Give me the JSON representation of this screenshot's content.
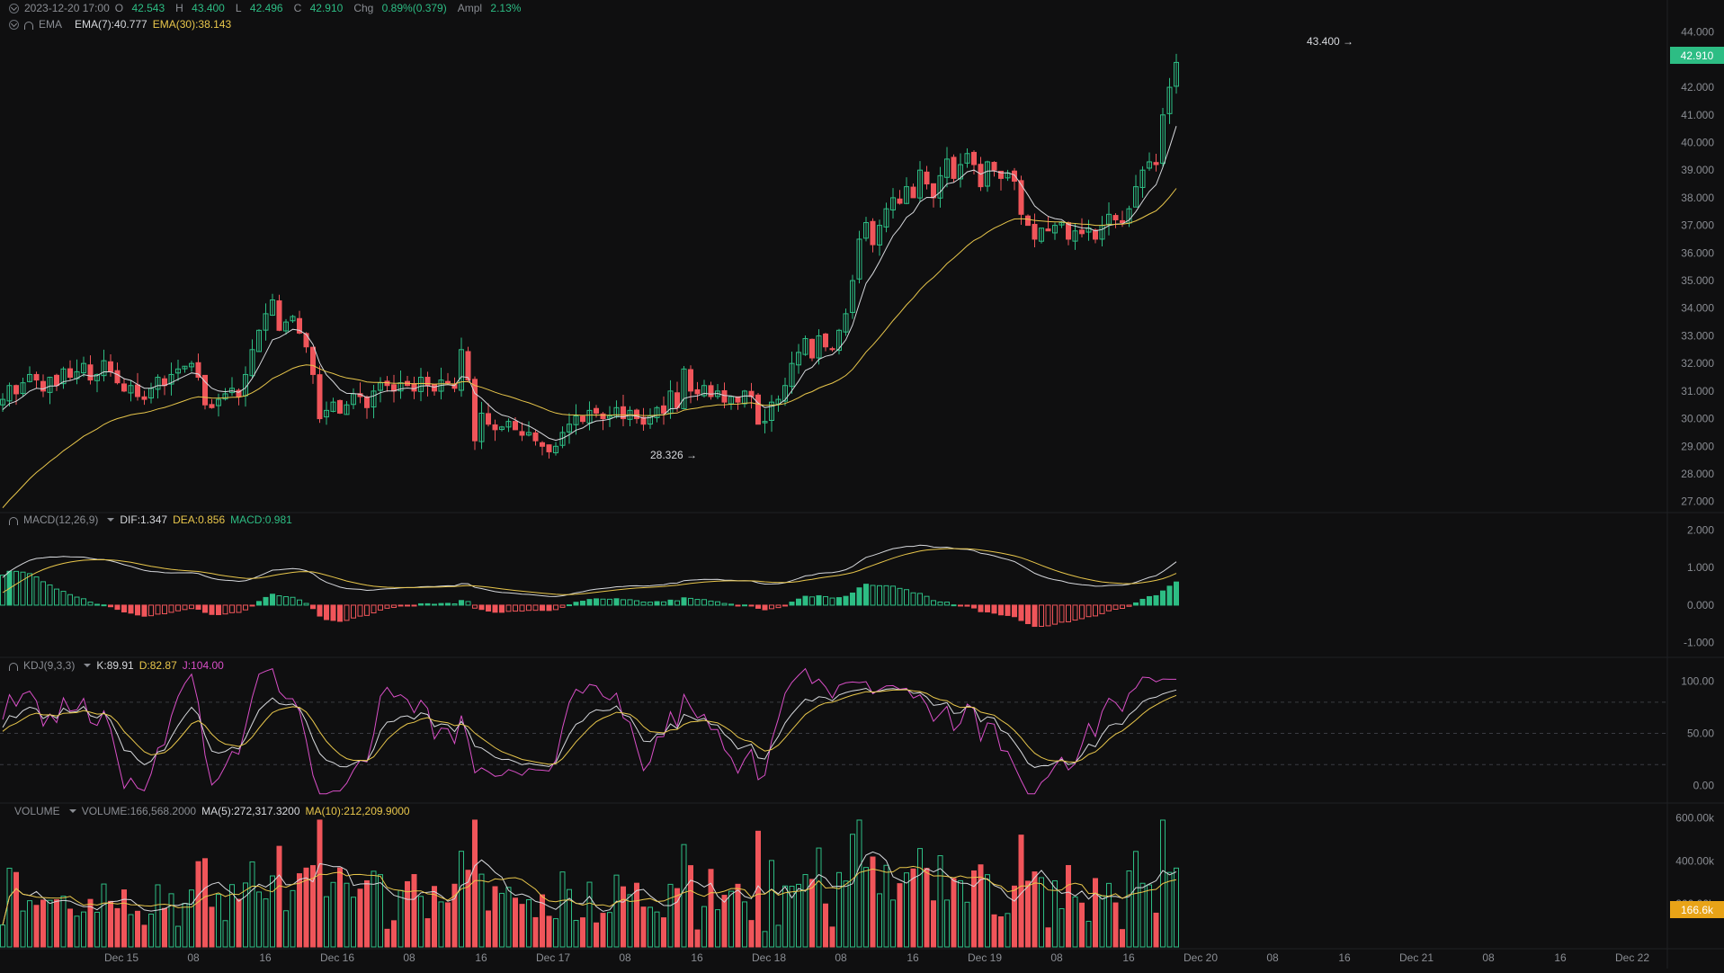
{
  "header": {
    "datetime": "2023-12-20 17:00",
    "open_label": "O",
    "open": "42.543",
    "high_label": "H",
    "high": "43.400",
    "low_label": "L",
    "low": "42.496",
    "close_label": "C",
    "close": "42.910",
    "chg_label": "Chg",
    "chg": "0.89%(0.379)",
    "ampl_label": "Ampl",
    "ampl": "2.13%",
    "ema_label": "EMA",
    "ema7": "EMA(7):40.777",
    "ema30": "EMA(30):38.143"
  },
  "macd_legend": {
    "name": "MACD(12,26,9)",
    "dif": "DIF:1.347",
    "dea": "DEA:0.856",
    "macd": "MACD:0.981"
  },
  "kdj_legend": {
    "name": "KDJ(9,3,3)",
    "k": "K:89.91",
    "d": "D:82.87",
    "j": "J:104.00"
  },
  "volume_legend": {
    "name": "VOLUME",
    "volume": "VOLUME:166,568.2000",
    "ma5": "MA(5):272,317.3200",
    "ma10": "MA(10):212,209.9000"
  },
  "annotations": {
    "high_marker": "43.400 →",
    "low_marker": "28.326 →"
  },
  "price_tags": {
    "last_price": "42.910",
    "last_volume": "166.6k"
  },
  "colors": {
    "up": "#2dbd84",
    "down": "#f0555a",
    "ema_fast": "#d6d8dc",
    "ema_slow": "#e8c64b",
    "j_line": "#d94fc7",
    "background": "#0f0f10"
  },
  "chart_data": {
    "type": "candlestick",
    "interval": "1h",
    "x_ticks": [
      "Dec 15",
      "08",
      "16",
      "Dec 16",
      "08",
      "16",
      "Dec 17",
      "08",
      "16",
      "Dec 18",
      "08",
      "16",
      "Dec 19",
      "08",
      "16",
      "Dec 20",
      "08",
      "16",
      "Dec 21",
      "08",
      "16",
      "Dec 22"
    ],
    "price_axis": {
      "ticks": [
        "44.000",
        "43.000",
        "42.000",
        "41.000",
        "40.000",
        "39.000",
        "38.000",
        "37.000",
        "36.000",
        "35.000",
        "34.000",
        "33.000",
        "32.000",
        "31.000",
        "30.000",
        "29.000",
        "28.000",
        "27.000"
      ],
      "range": [
        26.6,
        44.9
      ]
    },
    "macd_axis": {
      "ticks": [
        "2.000",
        "1.000",
        "0.000",
        "-1.000"
      ],
      "range": [
        -1.2,
        2.3
      ]
    },
    "kdj_axis": {
      "ticks": [
        "100.00",
        "50.00",
        "0.00"
      ],
      "range": [
        -10,
        117
      ],
      "dashed_levels": [
        80,
        50,
        20
      ]
    },
    "volume_axis": {
      "ticks": [
        "600.00k",
        "400.00k",
        "200.00k"
      ],
      "range": [
        0,
        640000
      ]
    },
    "candles_close": [
      30.7,
      31.2,
      30.9,
      31.3,
      31.6,
      31.4,
      31.0,
      31.5,
      31.2,
      31.8,
      31.5,
      31.7,
      32.0,
      31.4,
      31.6,
      32.1,
      31.7,
      31.3,
      31.0,
      31.2,
      30.8,
      30.7,
      31.1,
      31.5,
      31.2,
      31.6,
      31.8,
      31.9,
      32.0,
      31.5,
      30.5,
      30.4,
      30.7,
      30.9,
      31.1,
      30.8,
      31.6,
      32.5,
      33.2,
      33.8,
      34.3,
      33.2,
      33.5,
      33.7,
      33.1,
      32.6,
      31.6,
      30.0,
      30.3,
      30.6,
      30.2,
      30.5,
      30.9,
      30.8,
      30.4,
      31.0,
      31.3,
      31.2,
      31.0,
      31.3,
      31.2,
      31.0,
      31.5,
      31.2,
      31.0,
      31.4,
      31.3,
      31.1,
      32.5,
      31.4,
      29.2,
      30.2,
      29.8,
      29.6,
      29.7,
      29.9,
      29.6,
      29.4,
      29.5,
      29.2,
      29.0,
      28.8,
      29.0,
      29.5,
      29.8,
      30.1,
      29.9,
      30.3,
      30.2,
      30.0,
      30.1,
      30.4,
      30.0,
      30.3,
      30.0,
      29.8,
      30.1,
      30.4,
      30.2,
      31.0,
      30.4,
      31.8,
      31.0,
      30.9,
      31.2,
      30.8,
      31.0,
      30.6,
      30.8,
      30.6,
      31.0,
      30.8,
      29.8,
      29.9,
      30.6,
      30.7,
      31.2,
      32.0,
      32.4,
      32.9,
      32.2,
      33.0,
      32.6,
      32.5,
      33.2,
      33.8,
      35.0,
      36.5,
      37.1,
      36.3,
      37.0,
      37.6,
      38.0,
      37.8,
      38.4,
      38.0,
      39.0,
      38.5,
      38.0,
      38.8,
      39.4,
      38.7,
      39.2,
      39.6,
      39.2,
      38.4,
      39.3,
      39.0,
      38.7,
      38.9,
      38.6,
      37.4,
      37.0,
      36.5,
      36.9,
      36.8,
      37.0,
      37.1,
      36.5,
      36.8,
      36.7,
      36.9,
      36.5,
      37.0,
      37.4,
      37.2,
      37.1,
      37.6,
      38.4,
      39.0,
      39.3,
      39.2,
      41.0,
      42.0,
      42.9
    ]
  }
}
